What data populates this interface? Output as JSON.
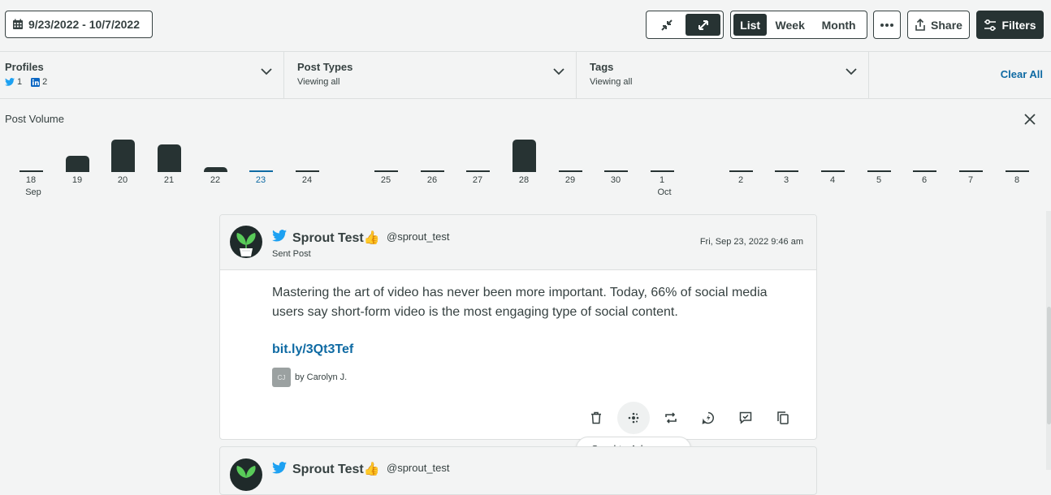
{
  "toolbar": {
    "date_range": "9/23/2022 - 10/7/2022",
    "view_options": [
      "List",
      "Week",
      "Month"
    ],
    "active_view": "List",
    "share_label": "Share",
    "filters_label": "Filters"
  },
  "filters": {
    "profiles_title": "Profiles",
    "twitter_count": "1",
    "linkedin_count": "2",
    "post_types_title": "Post Types",
    "post_types_value": "Viewing all",
    "tags_title": "Tags",
    "tags_value": "Viewing all",
    "clear_all": "Clear All"
  },
  "volume": {
    "title": "Post Volume",
    "days": [
      {
        "label": "18",
        "month": "Sep",
        "count": 0
      },
      {
        "label": "19",
        "count": 1
      },
      {
        "label": "20",
        "count": 2
      },
      {
        "label": "21",
        "count": 1.7
      },
      {
        "label": "22",
        "count": 0.3
      },
      {
        "label": "23",
        "count": 0,
        "active": true
      },
      {
        "label": "24",
        "count": 0
      },
      {
        "label": "25",
        "count": 0
      },
      {
        "label": "26",
        "count": 0
      },
      {
        "label": "27",
        "count": 0
      },
      {
        "label": "28",
        "count": 2
      },
      {
        "label": "29",
        "count": 0
      },
      {
        "label": "30",
        "count": 0
      },
      {
        "label": "1",
        "month": "Oct",
        "count": 0
      },
      {
        "label": "2",
        "count": 0
      },
      {
        "label": "3",
        "count": 0
      },
      {
        "label": "4",
        "count": 0
      },
      {
        "label": "5",
        "count": 0
      },
      {
        "label": "6",
        "count": 0
      },
      {
        "label": "7",
        "count": 0
      },
      {
        "label": "8",
        "count": 0
      }
    ]
  },
  "post": {
    "account_name": "Sprout Test👍",
    "handle": "@sprout_test",
    "kind": "Sent Post",
    "date": "Fri, Sep 23, 2022 9:46 am",
    "body": "Mastering the art of video has never been more important. Today, 66% of social media users say short-form video is the most engaging type of social content.",
    "link": "bit.ly/3Qt3Tef",
    "author_initials": "CJ",
    "author": "by Carolyn J.",
    "tooltip": "Send to Advocacy"
  },
  "post2": {
    "account_name": "Sprout Test👍",
    "handle": "@sprout_test"
  },
  "colors": {
    "accent": "#0e6aa3",
    "dark": "#273333",
    "text": "#364141",
    "twitter": "#1da1f2",
    "linkedin": "#0a66c2"
  }
}
